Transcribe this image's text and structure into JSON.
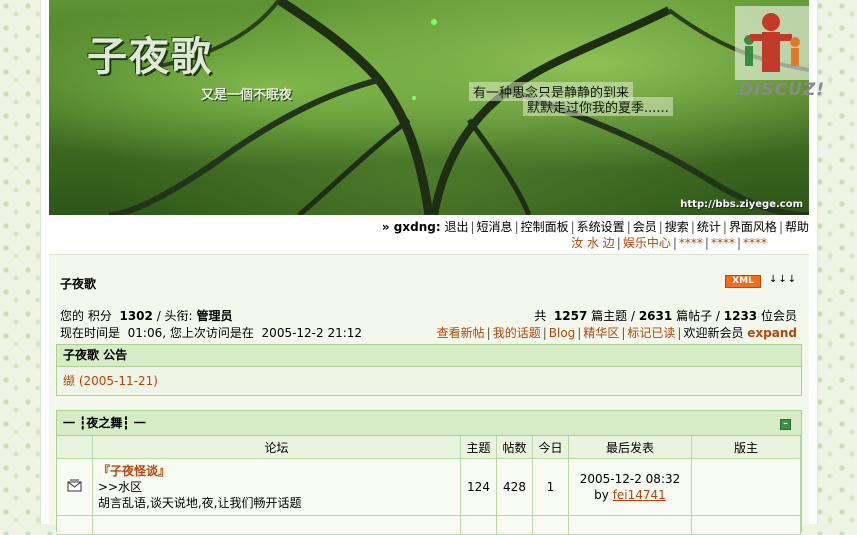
{
  "banner": {
    "title": "子夜歌",
    "subtitle": "又是一個不眠夜",
    "poem_line1": "有一种思念只是静静的到来",
    "poem_line2": "默默走过你我的夏季......",
    "url": "http://bbs.ziyege.com",
    "logo_text": "DISCUZ!"
  },
  "nav": {
    "user": "» gxdng:",
    "items": [
      "退出",
      "短消息",
      "控制面板",
      "系统设置",
      "会员",
      "搜索",
      "统计",
      "界面风格",
      "帮助"
    ],
    "items2": [
      "汝 水 边",
      "娱乐中心",
      "****",
      "****",
      "****"
    ]
  },
  "forum": {
    "name": "子夜歌",
    "xml_label": "XML",
    "arrows": "↓↓↓"
  },
  "user_info": {
    "prefix": "您的  积分",
    "points": "1302",
    "title_label": "/ 头衔:",
    "title": "管理员",
    "time_label": "现在时间是",
    "time": "01:06,",
    "last_visit_label": "您上次访问是在",
    "last_visit": "2005-12-2 21:12"
  },
  "stats": {
    "total_label": "共",
    "topics": "1257",
    "topics_label": "篇主题",
    "posts": "2631",
    "posts_label": "篇帖子",
    "members": "1233",
    "members_label": "位会员"
  },
  "quick_links": [
    "查看新帖",
    "我的话题",
    "Blog",
    "精华区",
    "标记已读"
  ],
  "welcome": "欢迎新会员",
  "new_member": "expand",
  "announcement": {
    "header": "子夜歌 公告",
    "item": "缬 (2005-11-21)"
  },
  "category": {
    "title": "一 ┇夜之舞┇ 一"
  },
  "table": {
    "headers": [
      "论坛",
      "主题",
      "帖数",
      "今日",
      "最后发表",
      "版主"
    ],
    "rows": [
      {
        "title": "『子夜怪谈』",
        "sub": ">>水区",
        "desc": "胡言乱语,谈天说地,夜,让我们畅开话题",
        "topics": "124",
        "posts": "428",
        "today": "1",
        "last_time": "2005-12-2 08:32",
        "last_by_label": "by",
        "last_by": "fei14741",
        "moderator": ""
      }
    ]
  }
}
